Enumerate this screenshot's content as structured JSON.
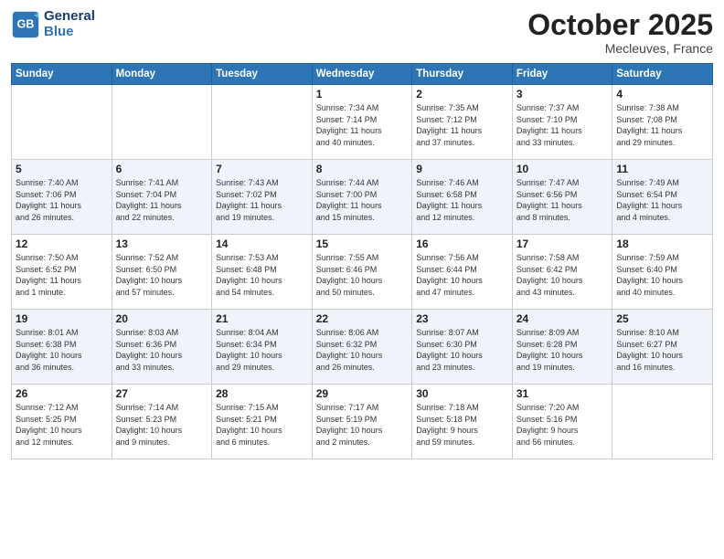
{
  "header": {
    "logo_line1": "General",
    "logo_line2": "Blue",
    "month": "October 2025",
    "location": "Mecleuves, France"
  },
  "weekdays": [
    "Sunday",
    "Monday",
    "Tuesday",
    "Wednesday",
    "Thursday",
    "Friday",
    "Saturday"
  ],
  "weeks": [
    [
      {
        "day": "",
        "info": ""
      },
      {
        "day": "",
        "info": ""
      },
      {
        "day": "",
        "info": ""
      },
      {
        "day": "1",
        "info": "Sunrise: 7:34 AM\nSunset: 7:14 PM\nDaylight: 11 hours\nand 40 minutes."
      },
      {
        "day": "2",
        "info": "Sunrise: 7:35 AM\nSunset: 7:12 PM\nDaylight: 11 hours\nand 37 minutes."
      },
      {
        "day": "3",
        "info": "Sunrise: 7:37 AM\nSunset: 7:10 PM\nDaylight: 11 hours\nand 33 minutes."
      },
      {
        "day": "4",
        "info": "Sunrise: 7:38 AM\nSunset: 7:08 PM\nDaylight: 11 hours\nand 29 minutes."
      }
    ],
    [
      {
        "day": "5",
        "info": "Sunrise: 7:40 AM\nSunset: 7:06 PM\nDaylight: 11 hours\nand 26 minutes."
      },
      {
        "day": "6",
        "info": "Sunrise: 7:41 AM\nSunset: 7:04 PM\nDaylight: 11 hours\nand 22 minutes."
      },
      {
        "day": "7",
        "info": "Sunrise: 7:43 AM\nSunset: 7:02 PM\nDaylight: 11 hours\nand 19 minutes."
      },
      {
        "day": "8",
        "info": "Sunrise: 7:44 AM\nSunset: 7:00 PM\nDaylight: 11 hours\nand 15 minutes."
      },
      {
        "day": "9",
        "info": "Sunrise: 7:46 AM\nSunset: 6:58 PM\nDaylight: 11 hours\nand 12 minutes."
      },
      {
        "day": "10",
        "info": "Sunrise: 7:47 AM\nSunset: 6:56 PM\nDaylight: 11 hours\nand 8 minutes."
      },
      {
        "day": "11",
        "info": "Sunrise: 7:49 AM\nSunset: 6:54 PM\nDaylight: 11 hours\nand 4 minutes."
      }
    ],
    [
      {
        "day": "12",
        "info": "Sunrise: 7:50 AM\nSunset: 6:52 PM\nDaylight: 11 hours\nand 1 minute."
      },
      {
        "day": "13",
        "info": "Sunrise: 7:52 AM\nSunset: 6:50 PM\nDaylight: 10 hours\nand 57 minutes."
      },
      {
        "day": "14",
        "info": "Sunrise: 7:53 AM\nSunset: 6:48 PM\nDaylight: 10 hours\nand 54 minutes."
      },
      {
        "day": "15",
        "info": "Sunrise: 7:55 AM\nSunset: 6:46 PM\nDaylight: 10 hours\nand 50 minutes."
      },
      {
        "day": "16",
        "info": "Sunrise: 7:56 AM\nSunset: 6:44 PM\nDaylight: 10 hours\nand 47 minutes."
      },
      {
        "day": "17",
        "info": "Sunrise: 7:58 AM\nSunset: 6:42 PM\nDaylight: 10 hours\nand 43 minutes."
      },
      {
        "day": "18",
        "info": "Sunrise: 7:59 AM\nSunset: 6:40 PM\nDaylight: 10 hours\nand 40 minutes."
      }
    ],
    [
      {
        "day": "19",
        "info": "Sunrise: 8:01 AM\nSunset: 6:38 PM\nDaylight: 10 hours\nand 36 minutes."
      },
      {
        "day": "20",
        "info": "Sunrise: 8:03 AM\nSunset: 6:36 PM\nDaylight: 10 hours\nand 33 minutes."
      },
      {
        "day": "21",
        "info": "Sunrise: 8:04 AM\nSunset: 6:34 PM\nDaylight: 10 hours\nand 29 minutes."
      },
      {
        "day": "22",
        "info": "Sunrise: 8:06 AM\nSunset: 6:32 PM\nDaylight: 10 hours\nand 26 minutes."
      },
      {
        "day": "23",
        "info": "Sunrise: 8:07 AM\nSunset: 6:30 PM\nDaylight: 10 hours\nand 23 minutes."
      },
      {
        "day": "24",
        "info": "Sunrise: 8:09 AM\nSunset: 6:28 PM\nDaylight: 10 hours\nand 19 minutes."
      },
      {
        "day": "25",
        "info": "Sunrise: 8:10 AM\nSunset: 6:27 PM\nDaylight: 10 hours\nand 16 minutes."
      }
    ],
    [
      {
        "day": "26",
        "info": "Sunrise: 7:12 AM\nSunset: 5:25 PM\nDaylight: 10 hours\nand 12 minutes."
      },
      {
        "day": "27",
        "info": "Sunrise: 7:14 AM\nSunset: 5:23 PM\nDaylight: 10 hours\nand 9 minutes."
      },
      {
        "day": "28",
        "info": "Sunrise: 7:15 AM\nSunset: 5:21 PM\nDaylight: 10 hours\nand 6 minutes."
      },
      {
        "day": "29",
        "info": "Sunrise: 7:17 AM\nSunset: 5:19 PM\nDaylight: 10 hours\nand 2 minutes."
      },
      {
        "day": "30",
        "info": "Sunrise: 7:18 AM\nSunset: 5:18 PM\nDaylight: 9 hours\nand 59 minutes."
      },
      {
        "day": "31",
        "info": "Sunrise: 7:20 AM\nSunset: 5:16 PM\nDaylight: 9 hours\nand 56 minutes."
      },
      {
        "day": "",
        "info": ""
      }
    ]
  ]
}
